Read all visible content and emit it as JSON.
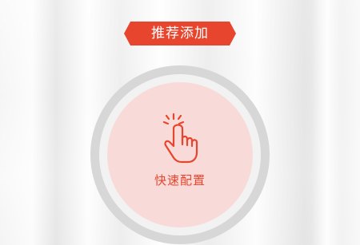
{
  "banner": {
    "label": "推荐添加"
  },
  "action": {
    "label": "快速配置",
    "icon": "tap-hand-icon"
  },
  "colors": {
    "accent": "#e8452e",
    "circle_fill": "#f8dbd8",
    "ring": "#d7d7d7"
  }
}
